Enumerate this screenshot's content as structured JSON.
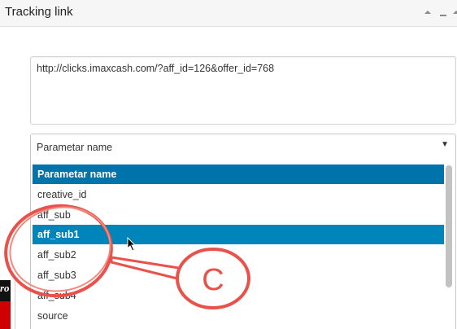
{
  "panel": {
    "title": "Tracking link"
  },
  "url_field": {
    "value": "http://clicks.imaxcash.com/?aff_id=126&offer_id=768"
  },
  "parameter_select": {
    "selected": "Parametar name",
    "options": [
      "Parametar name",
      "creative_id",
      "aff_sub",
      "aff_sub1",
      "aff_sub2",
      "aff_sub3",
      "aff_sub4",
      "source"
    ],
    "hovered_option": "aff_sub1"
  },
  "annotation": {
    "label": "C",
    "color": "#e8524a"
  },
  "background_logo": {
    "text": "ro"
  },
  "colors": {
    "highlight": "#0073aa",
    "header_bg": "#f6f6f6"
  },
  "icons": [
    "collapse-icon",
    "minimize-icon",
    "dropdown-arrow-icon",
    "mouse-cursor-icon"
  ]
}
